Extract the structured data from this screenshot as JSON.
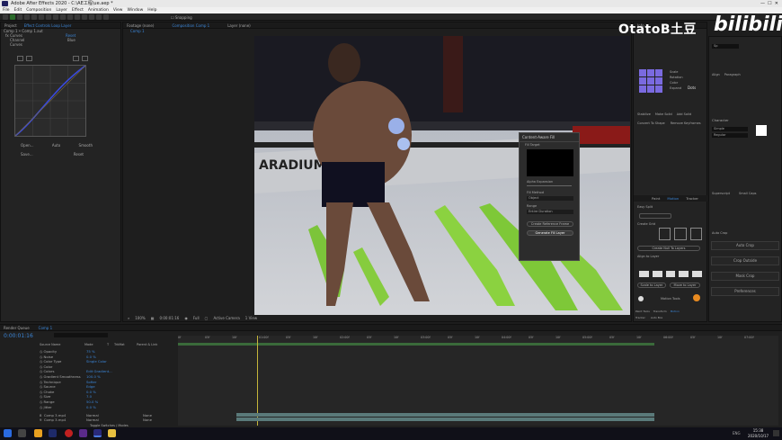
{
  "window": {
    "title": "Adobe After Effects 2020 - C:\\AE工程\\ue.aep *"
  },
  "menu": [
    "File",
    "Edit",
    "Composition",
    "Layer",
    "Effect",
    "Animation",
    "View",
    "Window",
    "Help"
  ],
  "toolbar": {
    "snapping": "Snapping"
  },
  "watermark": {
    "channel": "OtatoB土豆",
    "site": "bilibili"
  },
  "left_panel": {
    "tabs": [
      "Project",
      "Effect Controls Loop Layer"
    ],
    "layer": "Comp 1 • Comp 1.aut",
    "fx_label": "Curves",
    "reset": "Reset",
    "channel_label": "Channel",
    "channel_value": "Blue",
    "curves_label": "Curves",
    "bottom_row1": [
      "Open...",
      "Auto",
      "Smooth"
    ],
    "bottom_row2": [
      "Save...",
      "Reset"
    ]
  },
  "comp_panel": {
    "tabs": [
      "Footage (none)",
      "Composition Comp 1",
      "Layer (none)"
    ],
    "sub_tab": "Comp 1",
    "zoom": "100%",
    "timecode": "0:00:01:16",
    "quality": "Full",
    "camera": "Active Camera",
    "views": "1 View"
  },
  "dialog": {
    "title": "Content-Aware Fill",
    "fill_target": "Fill Target",
    "alpha_expansion": "Alpha Expansion",
    "fill_method": "Fill Method",
    "fill_method_value": "Object",
    "range": "Range",
    "range_value": "Entire Duration",
    "create_reference": "Create Reference Frame",
    "generate": "Generate Fill Layer"
  },
  "right_panel": {
    "title": "Info",
    "search": "Sp",
    "align": "Align",
    "paragraph": "Paragraph",
    "character": "Character",
    "font": "Simple",
    "style": "Regular",
    "superscript": "Superscript",
    "small_caps": "Small Caps",
    "controls": [
      "Scale",
      "Rotation",
      "Color",
      "Expand"
    ],
    "dots": "Dots",
    "actions": [
      "Stabilize",
      "Make Solid",
      "Add Solid"
    ],
    "convert": "Convert To Shape",
    "remove_keyframes": "Remove Keyframes",
    "tabs": [
      "Paint",
      "Motion",
      "Tracker",
      "Align"
    ],
    "buttons": [
      "Auto Crop",
      "Crop Outside",
      "Mask Crop",
      "Preferences"
    ],
    "opts": [
      "Auto Crop",
      "Crop Mode"
    ],
    "easy_split": "Easy Split",
    "create_grid": "Create Grid",
    "align_to_grid": "Align To Grid",
    "create_null": "Create Null To Layers",
    "align_to_layer": "Align to Layer",
    "scale_to_layer": "Scale to Layer",
    "move_to_layer": "Move to Layer",
    "motion_tools": "Motion Tools",
    "footer": [
      "Paint Tools",
      "Transform",
      "Motion",
      "Tracker",
      "Auto Box"
    ]
  },
  "timeline": {
    "tabs": [
      "Render Queue",
      "Comp 1"
    ],
    "timecode": "0:00:01:16",
    "headers": [
      "Source Name",
      "Mode",
      "T",
      "TrkMat",
      "Parent & Link"
    ],
    "properties": [
      {
        "name": "Opacity",
        "value": "75 %"
      },
      {
        "name": "Noise",
        "value": "0.0 %"
      },
      {
        "name": "Color Type",
        "value": "Single Color"
      },
      {
        "name": "Color",
        "value": ""
      },
      {
        "name": "Colors",
        "value": "Edit Gradient..."
      },
      {
        "name": "Gradient Smoothness",
        "value": "100.0 %"
      },
      {
        "name": "Technique",
        "value": "Softer"
      },
      {
        "name": "Source",
        "value": "Edge"
      },
      {
        "name": "Choke",
        "value": "0.0 %"
      },
      {
        "name": "Size",
        "value": "7.0"
      },
      {
        "name": "Range",
        "value": "50.0 %"
      },
      {
        "name": "Jitter",
        "value": "0.0 %"
      }
    ],
    "layers": [
      {
        "num": "8",
        "name": "Comp 3.mp4",
        "mode": "Normal",
        "parent": "None"
      },
      {
        "num": "9",
        "name": "Comp 3.mp4",
        "mode": "Normal",
        "parent": "None"
      }
    ],
    "ruler": [
      "0f",
      "05f",
      "10f",
      "01:00f",
      "05f",
      "10f",
      "02:00f",
      "05f",
      "10f",
      "03:00f",
      "05f",
      "10f",
      "04:00f",
      "05f",
      "10f",
      "05:00f",
      "05f",
      "10f",
      "06:00f",
      "05f",
      "10f",
      "07:00f"
    ],
    "footer": "Toggle Switches / Modes"
  },
  "taskbar": {
    "time": "15:38",
    "date": "2020/10/17",
    "lang": "ENG"
  }
}
